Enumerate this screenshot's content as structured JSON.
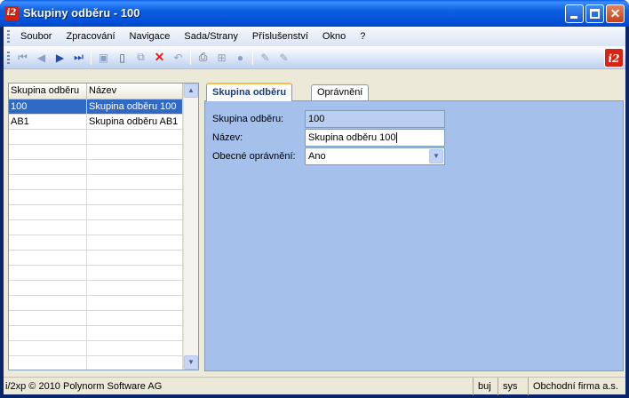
{
  "window": {
    "title": "Skupiny odběru - 100",
    "app_icon": "i2-logo-icon",
    "controls": [
      "minimize-icon",
      "maximize-icon",
      "close-icon"
    ]
  },
  "menu": [
    {
      "label": "Soubor"
    },
    {
      "label": "Zpracování"
    },
    {
      "label": "Navigace"
    },
    {
      "label": "Sada/Strany"
    },
    {
      "label": "Příslušenství"
    },
    {
      "label": "Okno"
    },
    {
      "label": "?"
    }
  ],
  "toolbar": {
    "icons": [
      "first-record-icon",
      "previous-record-icon",
      "next-record-icon",
      "last-record-icon",
      "save-icon",
      "new-icon",
      "copy-icon",
      "delete-icon",
      "undo-icon",
      "print-icon",
      "tree-icon",
      "lock-icon",
      "edit-icon",
      "edit-all-icon"
    ],
    "brand_icon": "i2-brand-icon"
  },
  "grid": {
    "columns": [
      "Skupina odběru",
      "Název"
    ],
    "rows": [
      {
        "code": "100",
        "name": "Skupina odběru 100",
        "selected": true
      },
      {
        "code": "AB1",
        "name": "Skupina odběru AB1",
        "selected": false
      }
    ],
    "empty_rows": 16
  },
  "tabs": [
    {
      "label": "Skupina odběru",
      "active": true
    },
    {
      "label": "Oprávnění",
      "active": false
    }
  ],
  "form": {
    "group_label": "Skupina odběru:",
    "group_value": "100",
    "name_label": "Název:",
    "name_value": "Skupina odběru 100",
    "perm_label": "Obecné oprávnění:",
    "perm_value": "Ano"
  },
  "status": {
    "copyright": "i/2xp © 2010 Polynorm Software AG",
    "user": "buj",
    "db": "sys",
    "company": "Obchodní firma a.s."
  },
  "colors": {
    "title_bar": "#0050d8",
    "selection": "#316ac5",
    "panel": "#a6c0ec",
    "delete": "#e0201a",
    "brand": "#d52515"
  }
}
